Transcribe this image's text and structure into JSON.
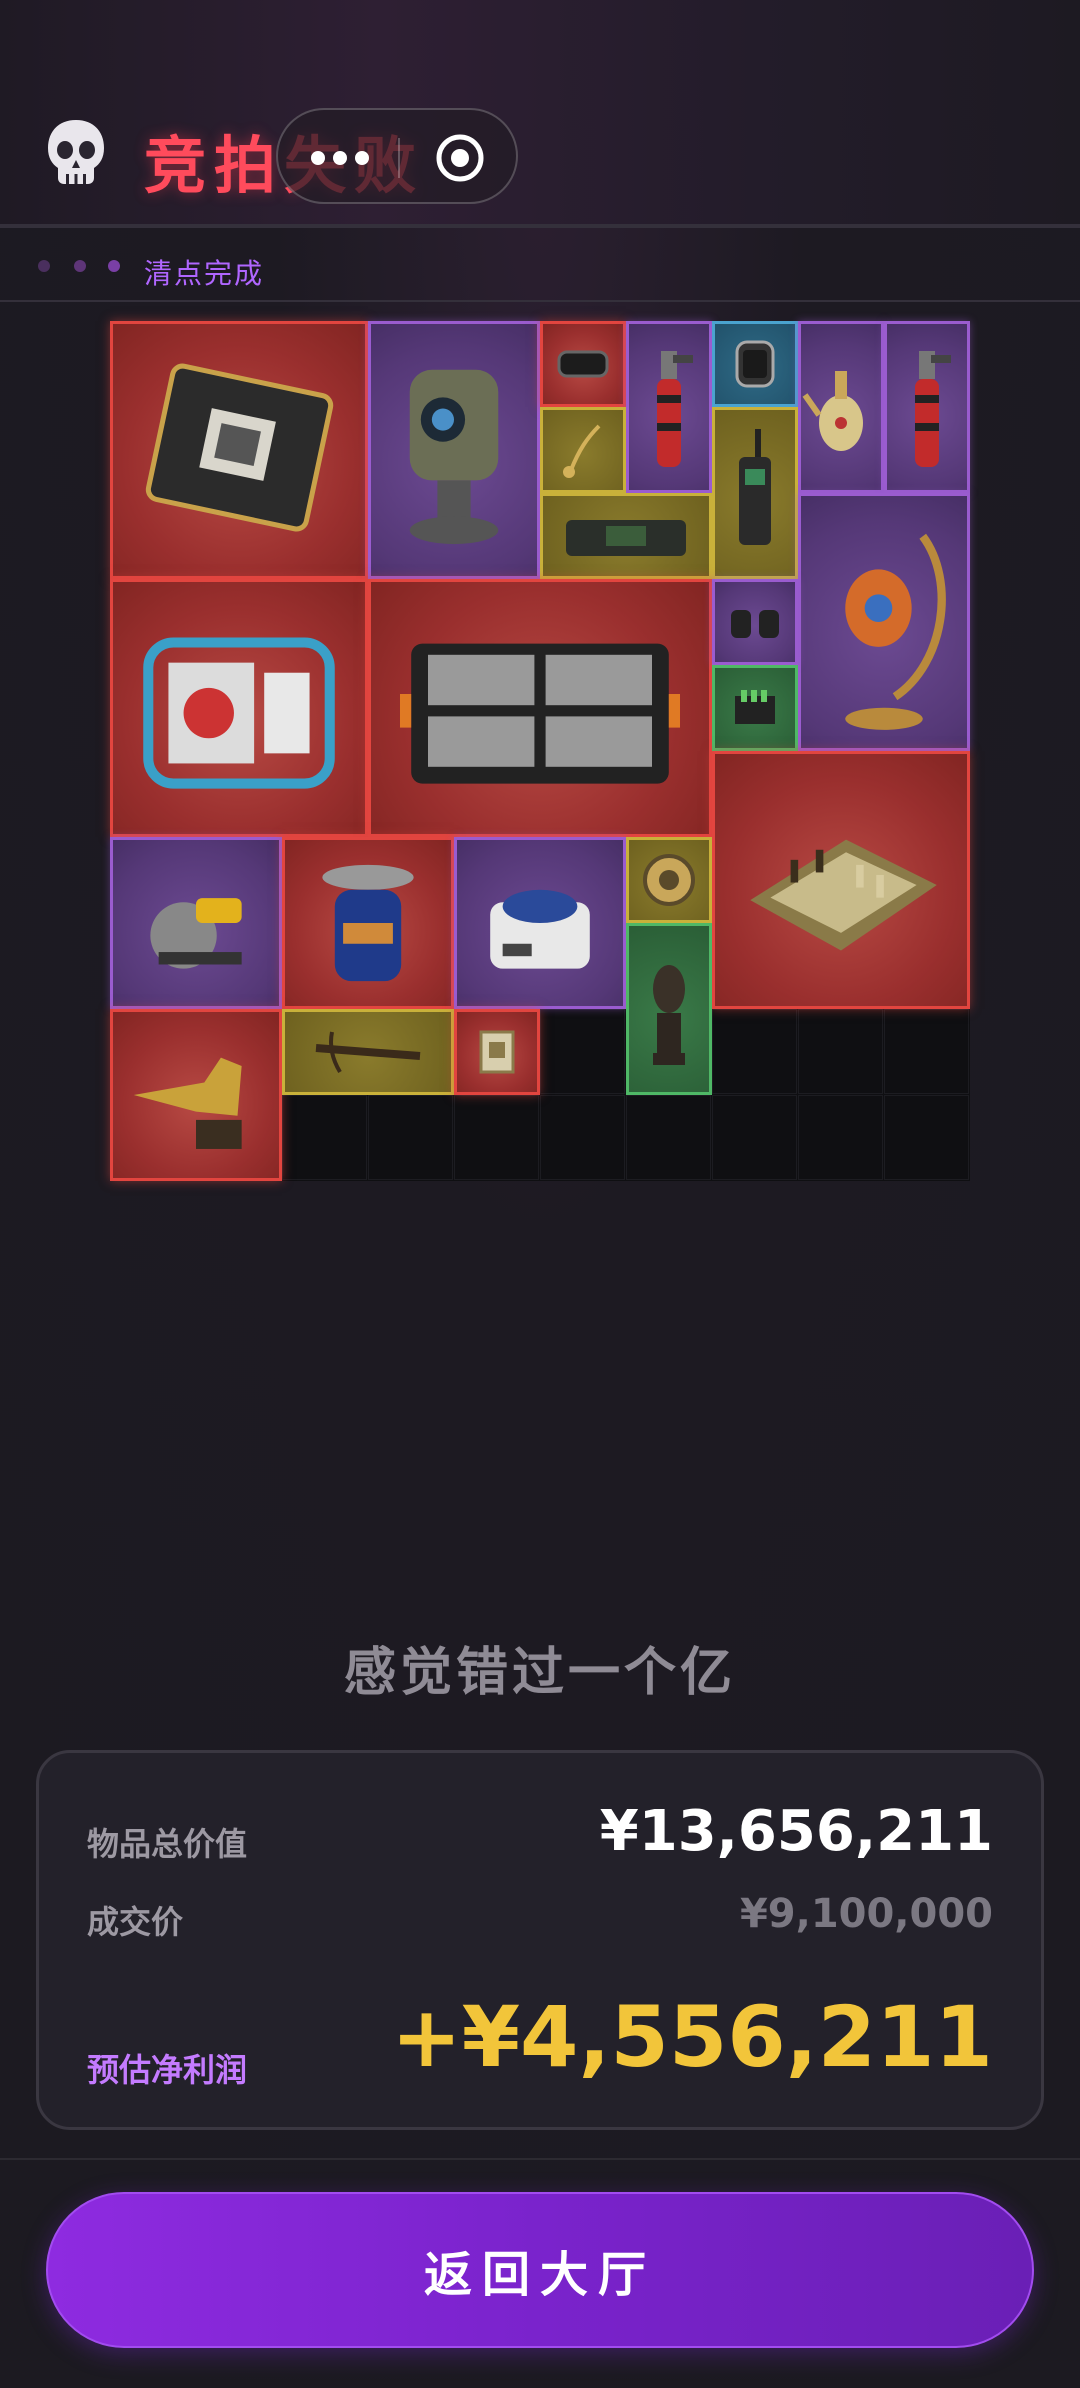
{
  "header": {
    "title": "竞拍失败",
    "icon": "skull-icon",
    "menu_icon": "more-dots-icon",
    "close_icon": "target-icon",
    "accent_color": "#ff4b5c"
  },
  "status": {
    "text": "清点完成",
    "color": "#b066ff"
  },
  "grid": {
    "columns": 10,
    "rows": 10,
    "items": [
      {
        "name": "circuit-board",
        "rarity": "red",
        "icon": "circuit-board-icon"
      },
      {
        "name": "sentry-turret",
        "rarity": "purple",
        "icon": "turret-icon"
      },
      {
        "name": "wrist-watch-strap",
        "rarity": "red",
        "icon": "watch-strap-icon"
      },
      {
        "name": "torch-lighter",
        "rarity": "purple",
        "icon": "torch-icon"
      },
      {
        "name": "smart-watch",
        "rarity": "blue",
        "icon": "smartwatch-icon"
      },
      {
        "name": "golden-teapot",
        "rarity": "purple",
        "icon": "teapot-icon"
      },
      {
        "name": "torch-lighter-2",
        "rarity": "purple",
        "icon": "torch-icon"
      },
      {
        "name": "pendant-key",
        "rarity": "yellow",
        "icon": "pendant-icon"
      },
      {
        "name": "walkie-talkie",
        "rarity": "yellow",
        "icon": "radio-icon"
      },
      {
        "name": "control-device",
        "rarity": "yellow",
        "icon": "device-icon"
      },
      {
        "name": "ornate-lamp",
        "rarity": "purple",
        "icon": "lamp-icon"
      },
      {
        "name": "generator",
        "rarity": "red",
        "icon": "generator-icon"
      },
      {
        "name": "ammo-crate",
        "rarity": "red",
        "icon": "crate-icon"
      },
      {
        "name": "binoculars",
        "rarity": "purple",
        "icon": "binoculars-icon"
      },
      {
        "name": "battery-pack",
        "rarity": "green",
        "icon": "battery-icon"
      },
      {
        "name": "chess-set",
        "rarity": "red",
        "icon": "chess-icon"
      },
      {
        "name": "circular-saw",
        "rarity": "purple",
        "icon": "saw-icon"
      },
      {
        "name": "gas-canister",
        "rarity": "red",
        "icon": "gas-canister-icon"
      },
      {
        "name": "centrifuge",
        "rarity": "purple",
        "icon": "centrifuge-icon"
      },
      {
        "name": "compass-gear",
        "rarity": "yellow",
        "icon": "compass-icon"
      },
      {
        "name": "tribal-statue",
        "rarity": "green",
        "icon": "statue-icon"
      },
      {
        "name": "crocodile-statue",
        "rarity": "red",
        "icon": "crocodile-icon"
      },
      {
        "name": "crossbow",
        "rarity": "yellow",
        "icon": "crossbow-icon"
      },
      {
        "name": "chip-card",
        "rarity": "red",
        "icon": "chip-icon"
      }
    ],
    "rarity_colors": {
      "red": "#e2453f",
      "purple": "#9a5ccf",
      "yellow": "#c9b13a",
      "blue": "#4aa3cf",
      "green": "#4fb866"
    }
  },
  "summary": {
    "quote": "感觉错过一个亿",
    "total_label": "物品总价值",
    "total_value": "¥13,656,211",
    "deal_label": "成交价",
    "deal_value": "¥9,100,000",
    "profit_label": "预估净利润",
    "profit_value": "+¥4,556,211",
    "profit_color": "#f2c53a"
  },
  "cta": {
    "label": "返回大厅"
  }
}
